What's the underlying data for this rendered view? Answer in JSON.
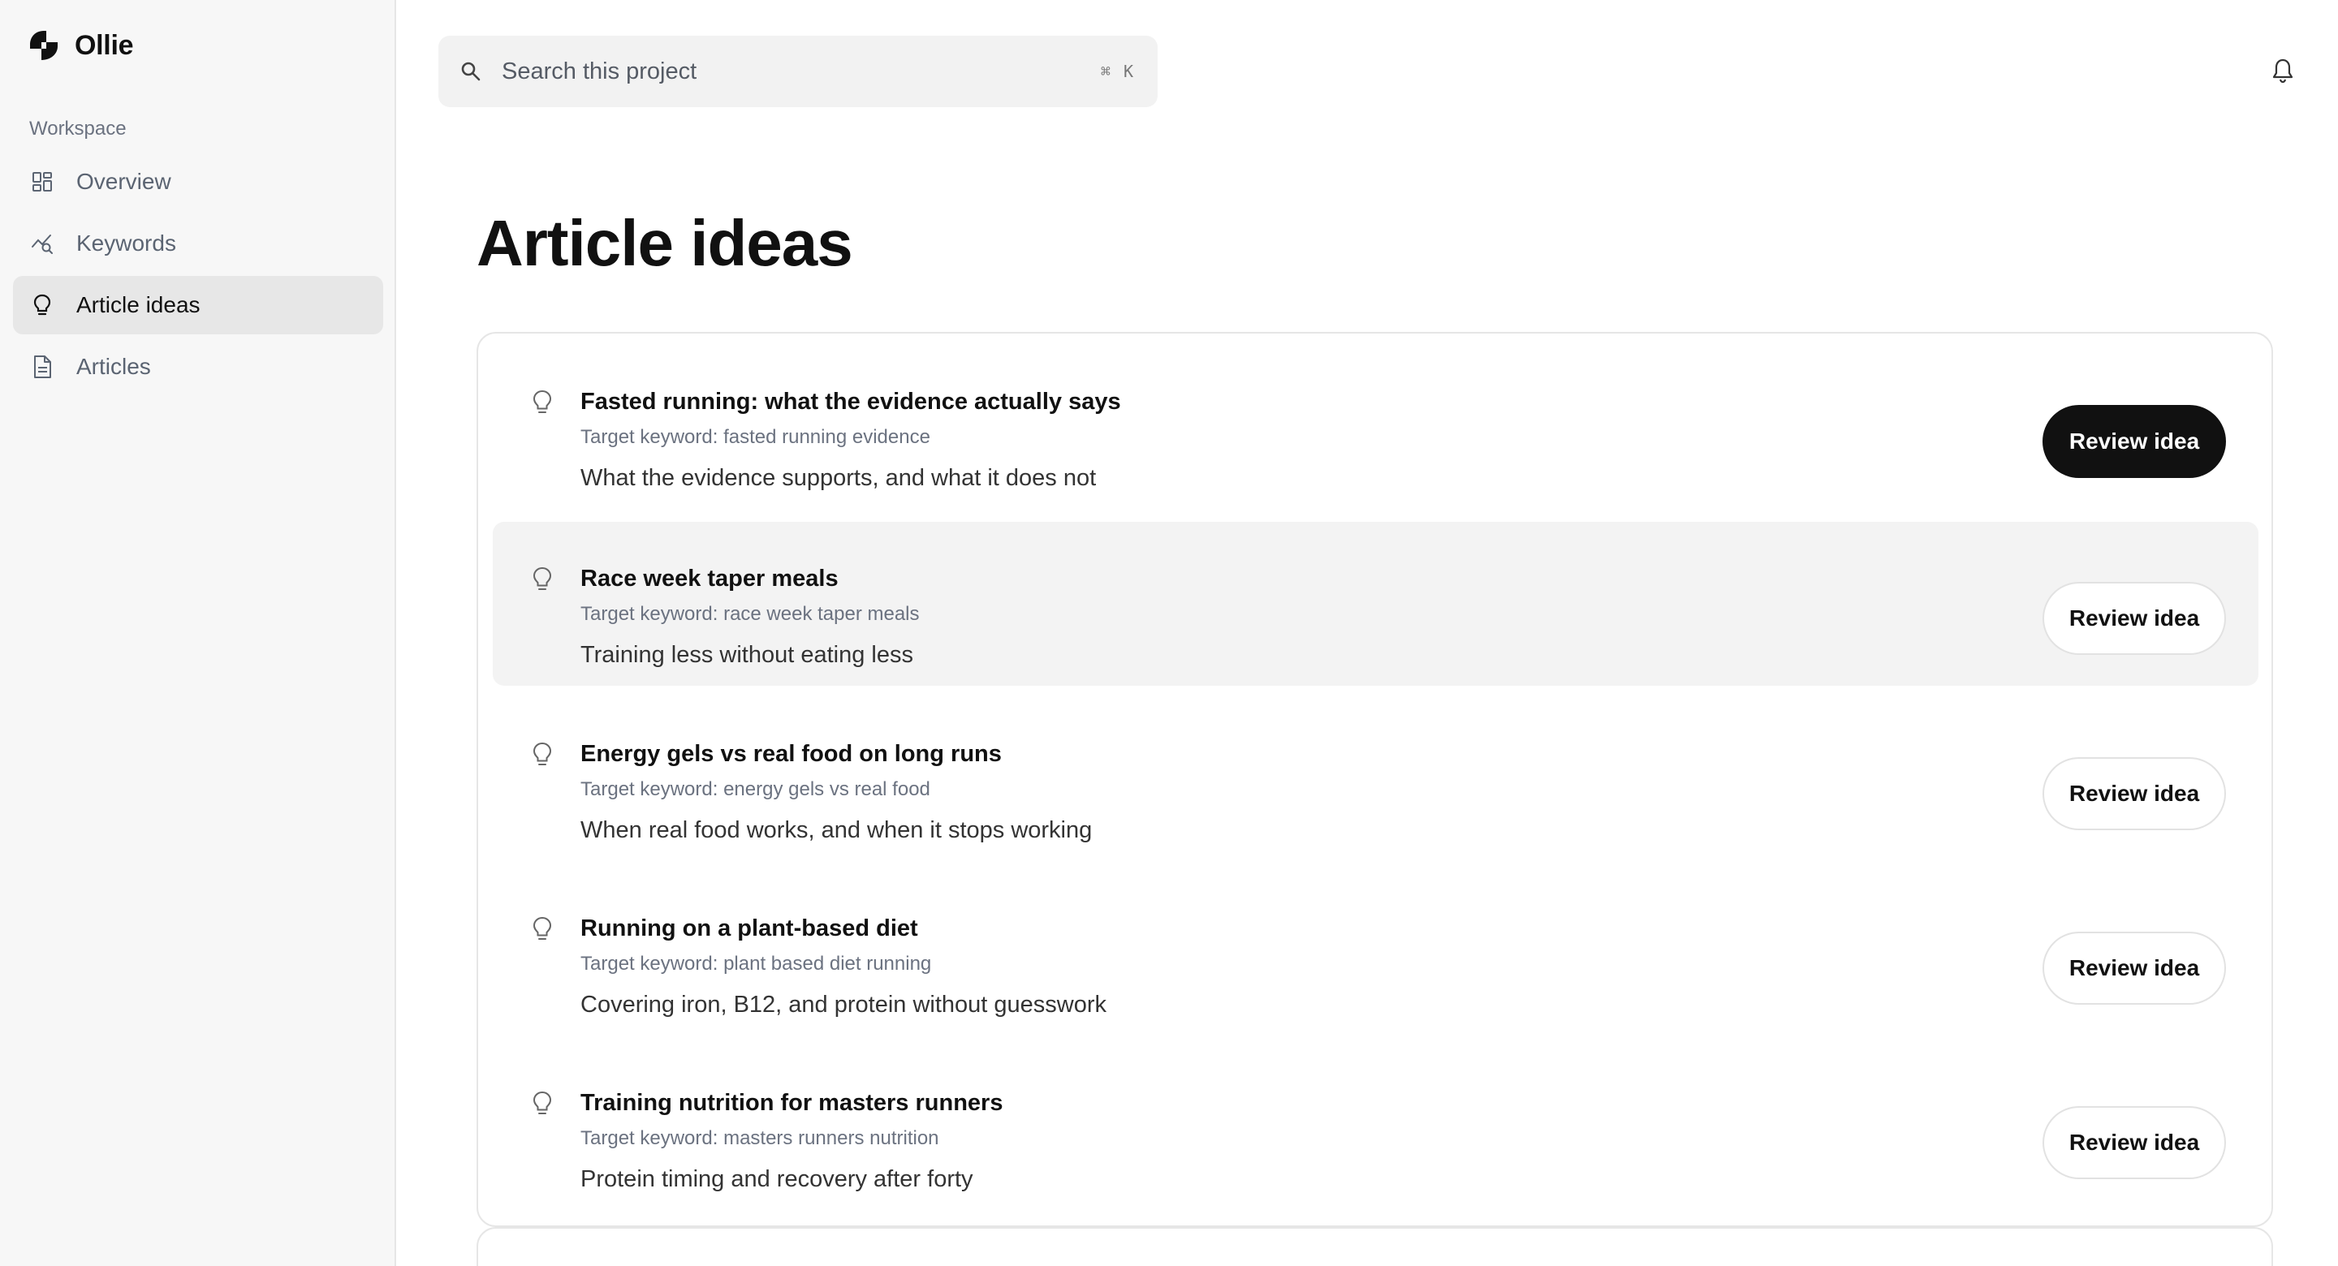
{
  "app": {
    "name": "Ollie"
  },
  "sidebar": {
    "section_label": "Workspace",
    "items": [
      {
        "label": "Overview",
        "icon": "grid-icon",
        "active": false
      },
      {
        "label": "Keywords",
        "icon": "trend-search-icon",
        "active": false
      },
      {
        "label": "Article ideas",
        "icon": "lightbulb-icon",
        "active": true
      },
      {
        "label": "Articles",
        "icon": "document-icon",
        "active": false
      }
    ]
  },
  "search": {
    "placeholder": "Search this project",
    "shortcut": "⌘ K"
  },
  "page": {
    "title": "Article ideas"
  },
  "ideas": [
    {
      "title": "Fasted running: what the evidence actually says",
      "keyword": "Target keyword: fasted running evidence",
      "description": "What the evidence supports, and what it does not",
      "button": "Review idea"
    },
    {
      "title": "Race week taper meals",
      "keyword": "Target keyword: race week taper meals",
      "description": "Training less without eating less",
      "button": "Review idea"
    },
    {
      "title": "Energy gels vs real food on long runs",
      "keyword": "Target keyword: energy gels vs real food",
      "description": "When real food works, and when it stops working",
      "button": "Review idea"
    },
    {
      "title": "Running on a plant-based diet",
      "keyword": "Target keyword: plant based diet running",
      "description": "Covering iron, B12, and protein without guesswork",
      "button": "Review idea"
    },
    {
      "title": "Training nutrition for masters runners",
      "keyword": "Target keyword: masters runners nutrition",
      "description": "Protein timing and recovery after forty",
      "button": "Review idea"
    }
  ],
  "colors": {
    "accent": "#111111",
    "sidebar_bg": "#f7f7f7",
    "active_bg": "#e7e7e7",
    "muted_text": "#6b7280"
  }
}
